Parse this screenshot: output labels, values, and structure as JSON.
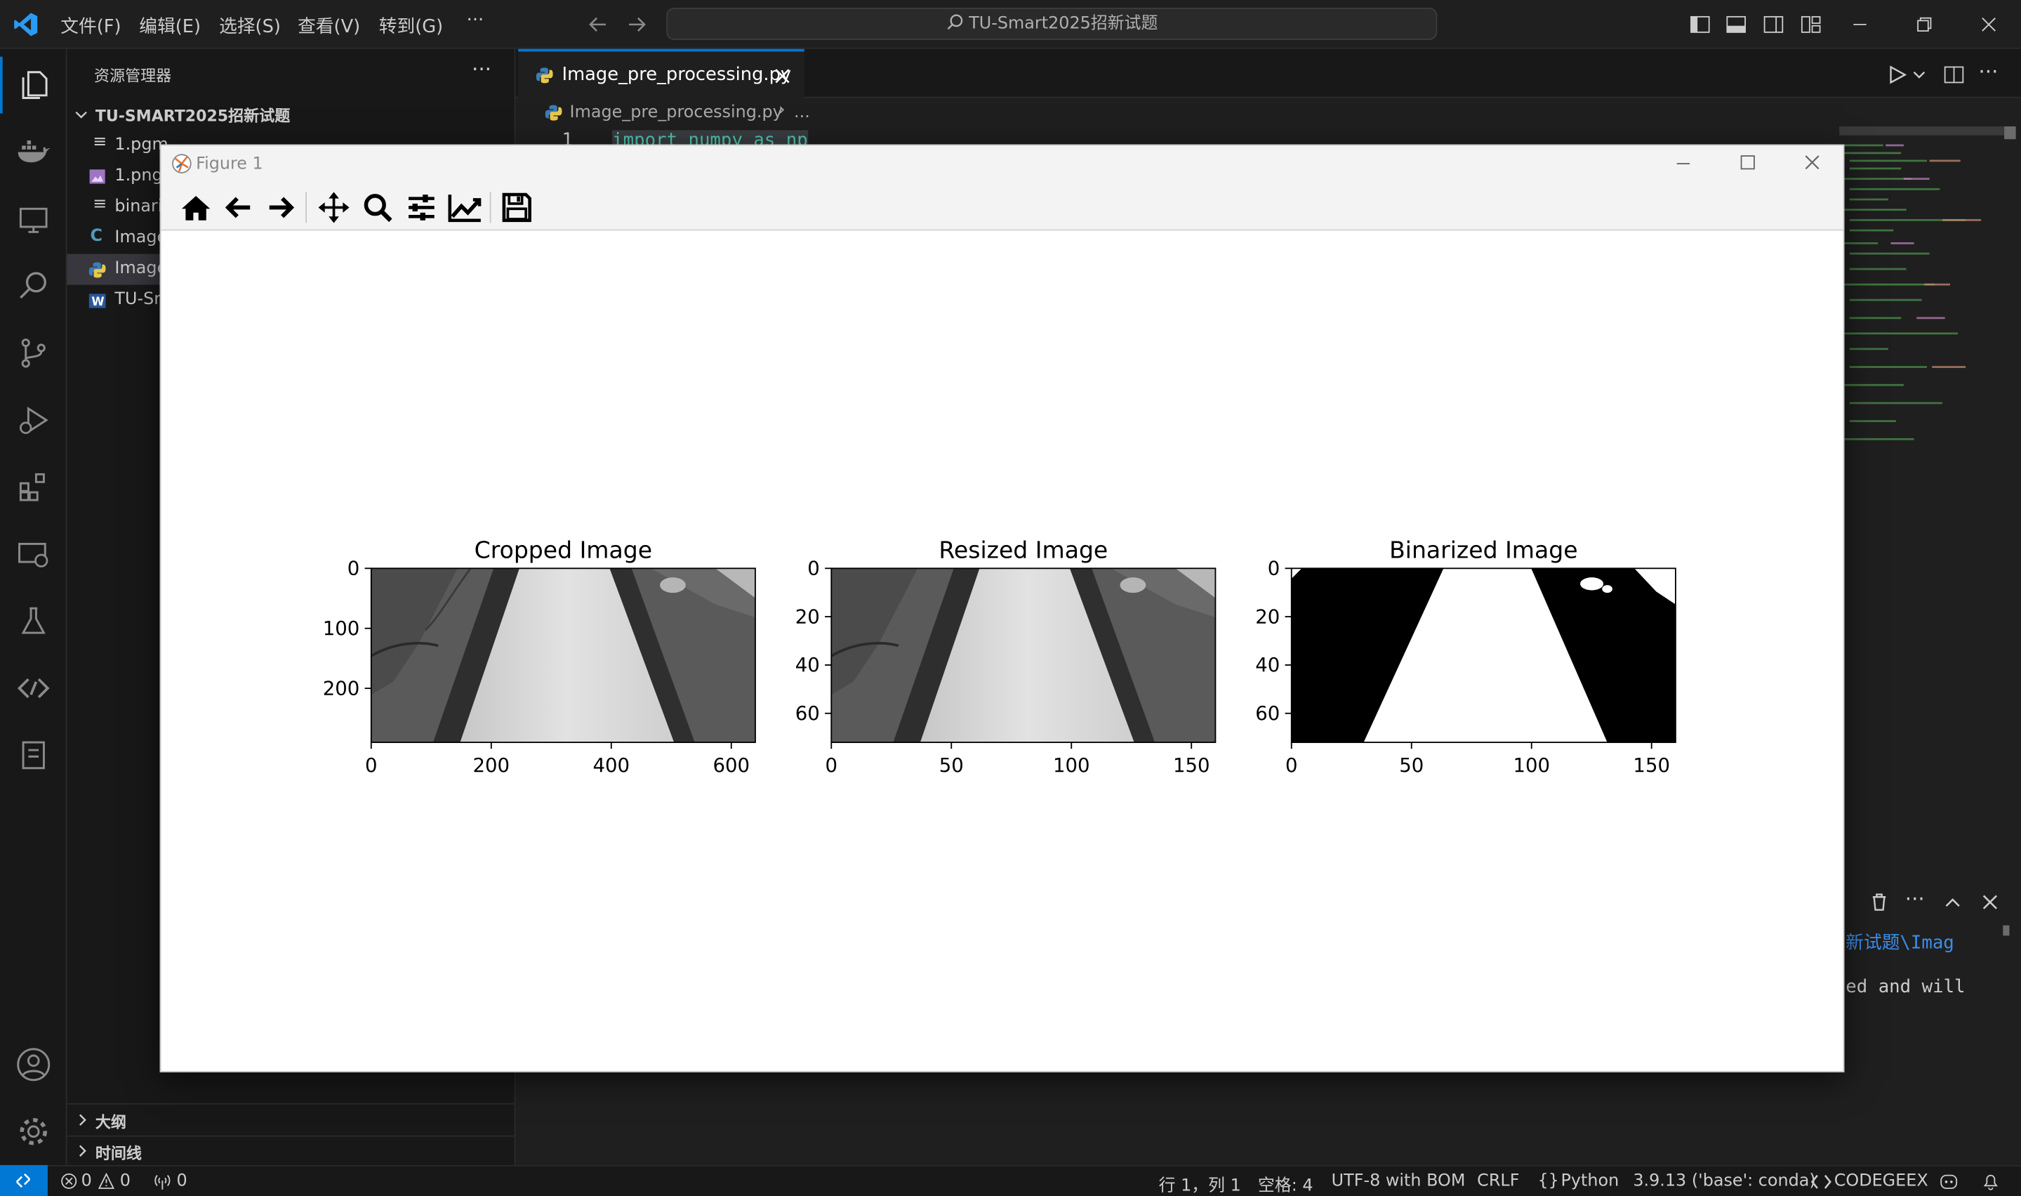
{
  "titlebar": {
    "menus": [
      "文件(F)",
      "编辑(E)",
      "选择(S)",
      "查看(V)",
      "转到(G)",
      "···"
    ],
    "search_text": "TU-Smart2025招新试题"
  },
  "sidebar": {
    "header": "资源管理器",
    "folder": "TU-SMART2025招新试题",
    "files": [
      "1.pgm",
      "1.png",
      "binari",
      "Image",
      "Image",
      "TU-Sr"
    ],
    "outline": "大纲",
    "timeline": "时间线"
  },
  "editor": {
    "tab_label": "Image_pre_processing.py",
    "breadcrumb_file": "Image_pre_processing.py",
    "breadcrumb_more": "...",
    "line_number": "1",
    "code_line": "import numpy as np",
    "terminal_line1": "新试题\\Imag",
    "terminal_line2": "ed and will"
  },
  "figure": {
    "window_title": "Figure 1"
  },
  "status": {
    "errors": "0",
    "warnings": "0",
    "ports": "0",
    "position": "行 1，列 1",
    "spaces": "空格: 4",
    "encoding": "UTF-8 with BOM",
    "eol": "CRLF",
    "language": "Python",
    "interpreter": "3.9.13 ('base': conda)",
    "codegeex": "CODEGEEX"
  },
  "chart_data": [
    {
      "type": "image",
      "title": "Cropped Image",
      "x_ticks": [
        0,
        200,
        400,
        600
      ],
      "y_ticks": [
        0,
        100,
        200
      ],
      "xlim": [
        0,
        640
      ],
      "ylim": [
        290,
        0
      ],
      "content": "grayscale road image"
    },
    {
      "type": "image",
      "title": "Resized Image",
      "x_ticks": [
        0,
        50,
        100,
        150
      ],
      "y_ticks": [
        0,
        20,
        40,
        60
      ],
      "xlim": [
        0,
        160
      ],
      "ylim": [
        72,
        0
      ],
      "content": "grayscale road image"
    },
    {
      "type": "image",
      "title": "Binarized Image",
      "x_ticks": [
        0,
        50,
        100,
        150
      ],
      "y_ticks": [
        0,
        20,
        40,
        60
      ],
      "xlim": [
        0,
        160
      ],
      "ylim": [
        72,
        0
      ],
      "content": "black and white road mask"
    }
  ]
}
